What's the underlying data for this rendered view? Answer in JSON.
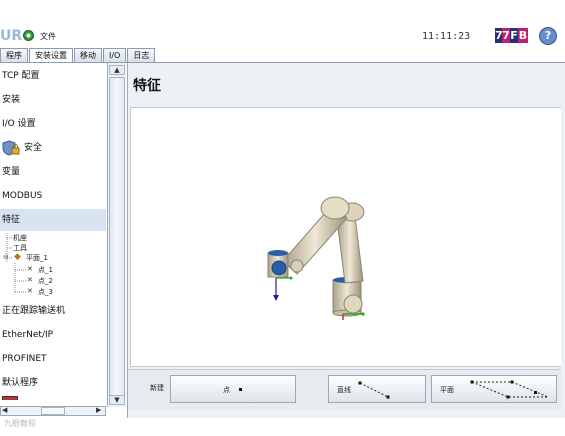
{
  "topbar": {
    "logo": "UR",
    "file_menu": "文件",
    "time": "11:11:23",
    "speed": [
      "7",
      "7",
      "F",
      "B"
    ],
    "help": "?"
  },
  "tabs": [
    "程序",
    "安装设置",
    "移动",
    "I/O",
    "日志"
  ],
  "active_tab": 1,
  "sidebar": {
    "items": [
      "TCP 配置",
      "安装",
      "I/O 设置",
      "安全",
      "变量",
      "MODBUS",
      "特征",
      "正在跟踪输送机",
      "EtherNet/IP",
      "PROFINET",
      "默认程序"
    ],
    "tree": [
      "机座",
      "工具",
      "平面_1",
      "点_1",
      "点_2",
      "点_3"
    ],
    "active_item": "特征"
  },
  "main": {
    "title": "特征",
    "zoom_icons": [
      "zoom-out-icon",
      "zoom-reset-icon",
      "zoom-in-icon"
    ],
    "new_label": "新建",
    "buttons": {
      "point": "点",
      "line": "直线",
      "plane": "平面"
    }
  },
  "watermark": "九眼教程",
  "colors": {
    "accent_selected": "#d7e3f1",
    "robot_joint": "#2a5fa8",
    "robot_link": "#d6ccb4"
  }
}
